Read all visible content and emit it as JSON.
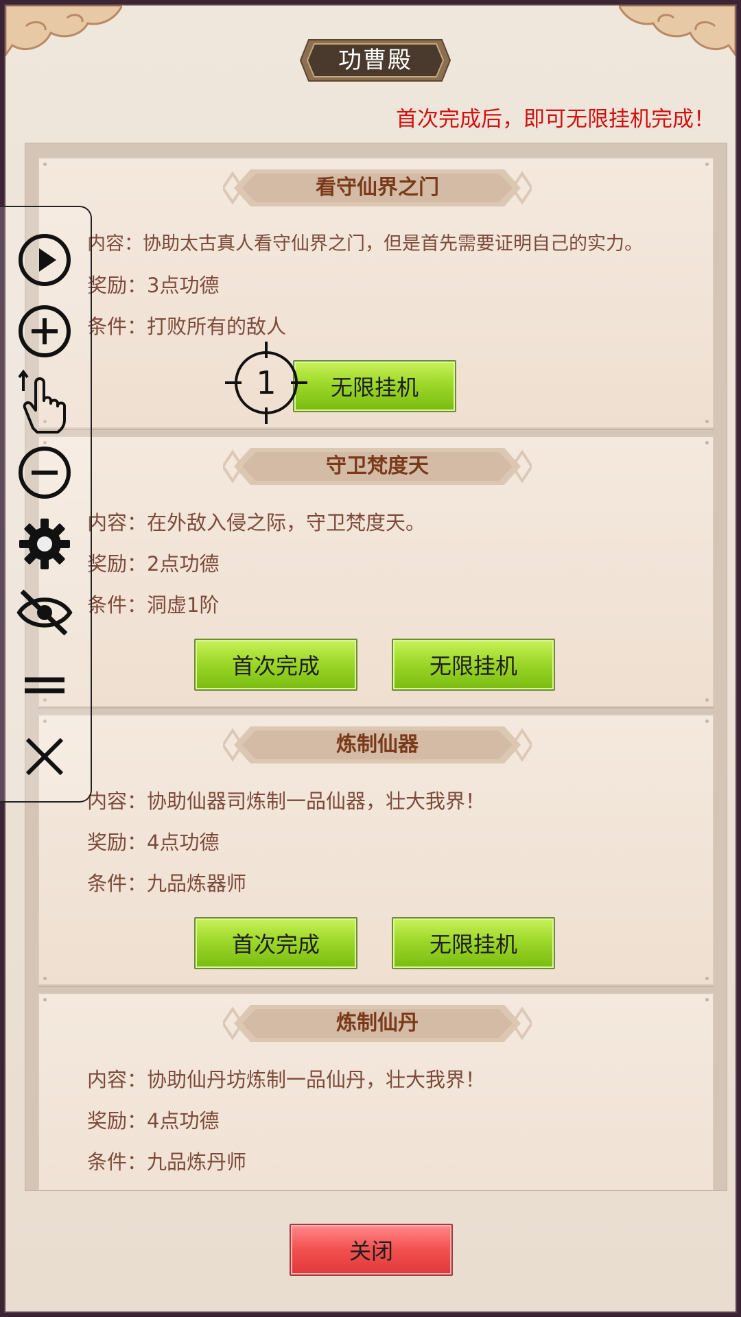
{
  "header": {
    "title": "功曹殿",
    "notice": "首次完成后，即可无限挂机完成！"
  },
  "tasks": [
    {
      "title": "看守仙界之门",
      "content": "内容：协助太古真人看守仙界之门，但是首先需要证明自己的实力。",
      "reward": "奖励：3点功德",
      "condition": "条件：打败所有的敌人",
      "buttons": [
        "无限挂机"
      ]
    },
    {
      "title": "守卫梵度天",
      "content": "内容：在外敌入侵之际，守卫梵度天。",
      "reward": "奖励：2点功德",
      "condition": "条件：洞虚1阶",
      "buttons": [
        "首次完成",
        "无限挂机"
      ]
    },
    {
      "title": "炼制仙器",
      "content": "内容：协助仙器司炼制一品仙器，壮大我界！",
      "reward": "奖励：4点功德",
      "condition": "条件：九品炼器师",
      "buttons": [
        "首次完成",
        "无限挂机"
      ]
    },
    {
      "title": "炼制仙丹",
      "content": "内容：协助仙丹坊炼制一品仙丹，壮大我界！",
      "reward": "奖励：4点功德",
      "condition": "条件：九品炼丹师",
      "buttons": []
    }
  ],
  "footer": {
    "close_label": "关闭"
  },
  "overlay": {
    "crosshair_label": "1",
    "tools": [
      "play-icon",
      "zoom-in-icon",
      "tap-gesture-icon",
      "zoom-out-icon",
      "gear-icon",
      "eye-off-icon",
      "menu-icon",
      "close-icon"
    ]
  },
  "colors": {
    "notice": "#d0110e",
    "green_button": "#9ed82a",
    "red_button": "#f2504f",
    "task_title": "#7a3a1a",
    "body_text": "#7c4a3a"
  }
}
